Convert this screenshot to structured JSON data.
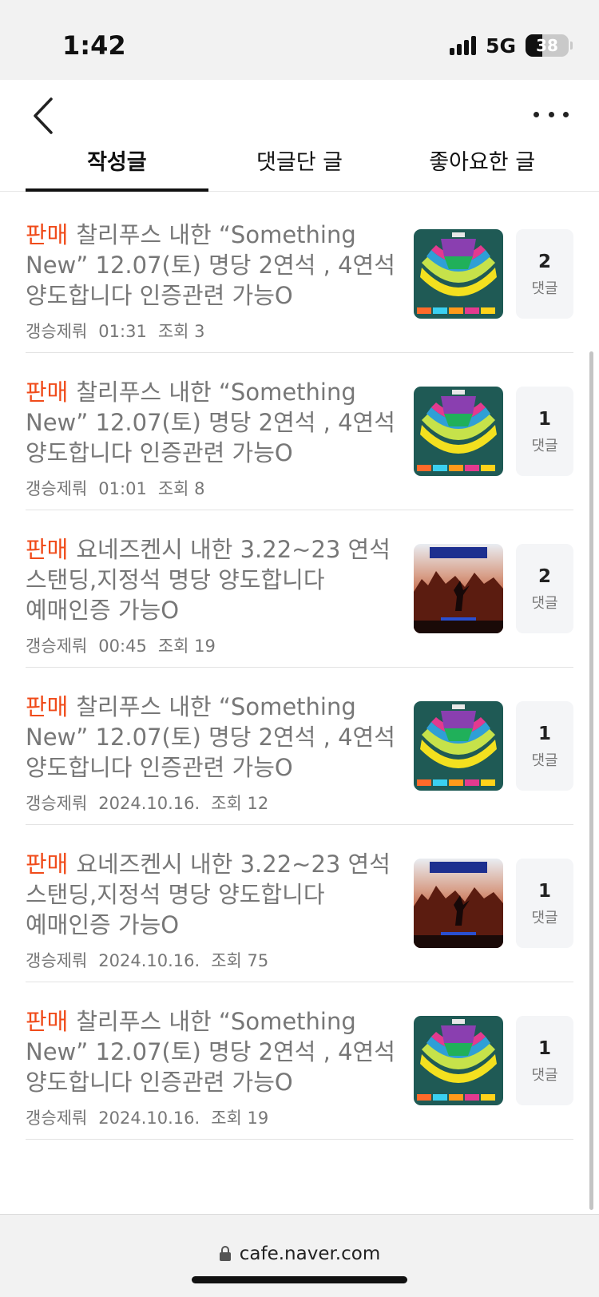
{
  "status_bar": {
    "time": "1:42",
    "network": "5G",
    "battery": "38",
    "battery_level": 0.38
  },
  "nav": {
    "back_icon": "chevron-left-icon",
    "more_icon": "more-dots-icon",
    "tabs": [
      {
        "label": "작성글",
        "active": true
      },
      {
        "label": "댓글단 글",
        "active": false
      },
      {
        "label": "좋아요한 글",
        "active": false
      }
    ]
  },
  "posts": [
    {
      "badge": "판매",
      "title": "찰리푸스 내한 “Something New” 12.07(토) 명당 2연석 , 4연석 양도합니다 인증관련 가능O",
      "author": "갱승제뤄",
      "time": "01:31",
      "views": "조회 3",
      "comments": "2",
      "comment_label": "댓글",
      "thumb": "seat-map"
    },
    {
      "badge": "판매",
      "title": "찰리푸스 내한 “Something New” 12.07(토) 명당 2연석 , 4연석 양도합니다 인증관련 가능O",
      "author": "갱승제뤄",
      "time": "01:01",
      "views": "조회 8",
      "comments": "1",
      "comment_label": "댓글",
      "thumb": "seat-map"
    },
    {
      "badge": "판매",
      "title": "요네즈켄시 내한 3.22~23 연석 스탠딩,지정석 명당 양도합니다 예매인증 가능O",
      "author": "갱승제뤄",
      "time": "00:45",
      "views": "조회 19",
      "comments": "2",
      "comment_label": "댓글",
      "thumb": "concert-poster"
    },
    {
      "badge": "판매",
      "title": "찰리푸스 내한 “Something New” 12.07(토) 명당 2연석 , 4연석 양도합니다 인증관련 가능O",
      "author": "갱승제뤄",
      "time": "2024.10.16.",
      "views": "조회 12",
      "comments": "1",
      "comment_label": "댓글",
      "thumb": "seat-map"
    },
    {
      "badge": "판매",
      "title": "요네즈켄시 내한 3.22~23 연석 스탠딩,지정석 명당 양도합니다 예매인증 가능O",
      "author": "갱승제뤄",
      "time": "2024.10.16.",
      "views": "조회 75",
      "comments": "1",
      "comment_label": "댓글",
      "thumb": "concert-poster"
    },
    {
      "badge": "판매",
      "title": "찰리푸스 내한 “Something New” 12.07(토) 명당 2연석 , 4연석 양도합니다 인증관련 가능O",
      "author": "갱승제뤄",
      "time": "2024.10.16.",
      "views": "조회 19",
      "comments": "1",
      "comment_label": "댓글",
      "thumb": "seat-map"
    }
  ],
  "url_bar": {
    "url": "cafe.naver.com",
    "lock_icon": "lock-icon"
  },
  "colors": {
    "badge": "#f04b1a",
    "muted": "#777777",
    "accent": "#111111"
  }
}
